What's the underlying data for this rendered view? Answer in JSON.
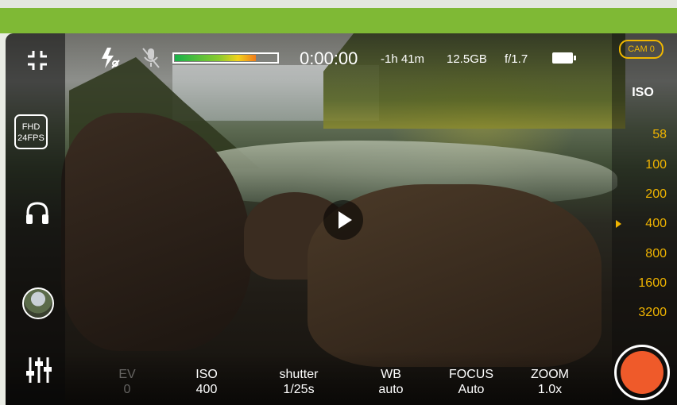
{
  "colors": {
    "accent_yellow": "#f0b400",
    "record_red": "#ef5a2a",
    "frame_green": "#7fb935"
  },
  "top_bar": {
    "icons": [
      "collapse-icon",
      "flash-auto-off-icon",
      "mic-muted-icon",
      "audio-meter",
      "battery-icon"
    ],
    "timecode": "0:00:00",
    "remaining_time": "-1h 41m",
    "storage": "12.5GB",
    "aperture": "f/1.7",
    "audio_level_fraction": 0.8,
    "camera_badge": "CAM 0"
  },
  "left_sidebar": {
    "resolution_top": "FHD",
    "resolution_bottom": "24FPS",
    "icons": [
      "collapse-icon",
      "resolution-badge",
      "headphones-icon",
      "gallery-thumbnail",
      "sliders-icon"
    ]
  },
  "iso_panel": {
    "header": "ISO",
    "values": [
      "58",
      "100",
      "200",
      "400",
      "800",
      "1600",
      "3200"
    ],
    "selected": "400"
  },
  "controls": [
    {
      "label": "EV",
      "value": "0",
      "active": false
    },
    {
      "label": "ISO",
      "value": "400",
      "active": true
    },
    {
      "label": "shutter",
      "value": "1/25s",
      "active": true
    },
    {
      "label": "WB",
      "value": "auto",
      "active": true
    },
    {
      "label": "FOCUS",
      "value": "Auto",
      "active": true
    },
    {
      "label": "ZOOM",
      "value": "1.0x",
      "active": true
    }
  ]
}
